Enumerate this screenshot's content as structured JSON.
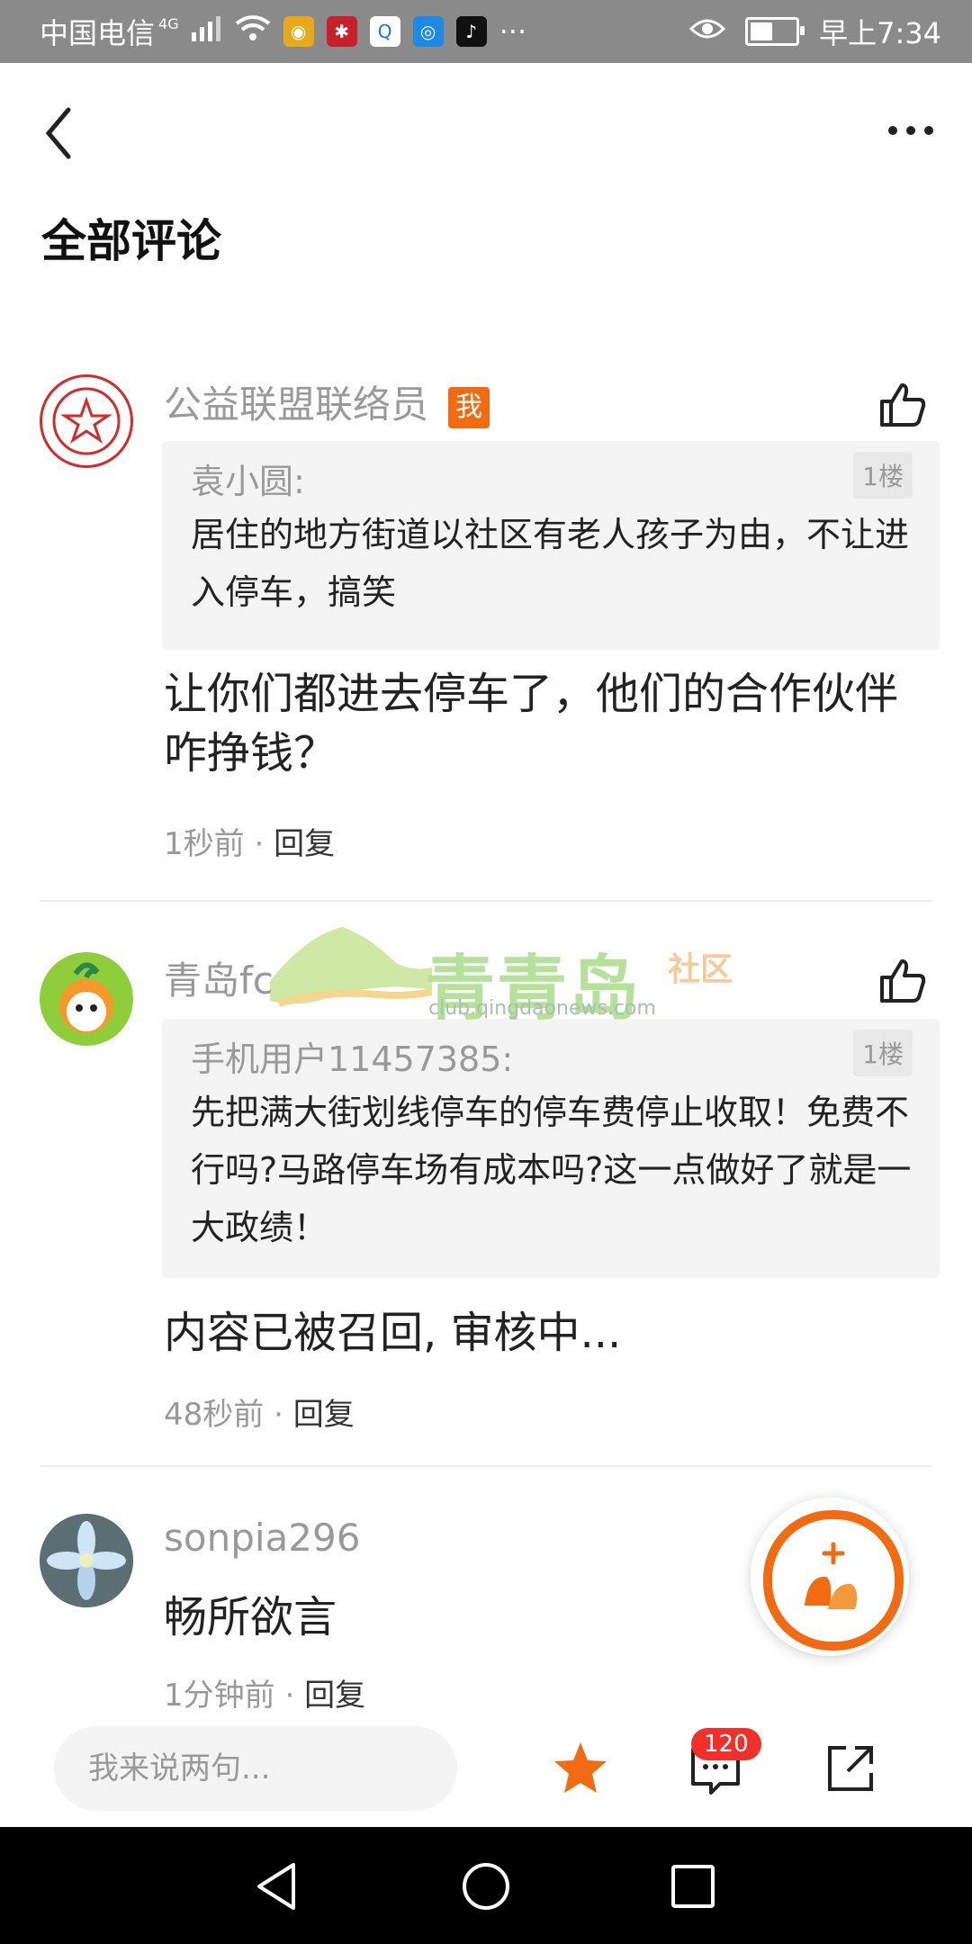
{
  "status_bar": {
    "carrier": "中国电信",
    "network": "4G",
    "more": "···",
    "time": "早上7:34"
  },
  "header": {
    "title": "全部评论"
  },
  "comments": [
    {
      "username": "公益联盟联络员",
      "me_tag": "我",
      "quote": {
        "user": "袁小圆:",
        "floor": "1楼",
        "text": "居住的地方街道以社区有老人孩子为由，不让进入停车，搞笑"
      },
      "text": "让你们都进去停车了，他们的合作伙伴咋挣钱？",
      "time": "1秒前",
      "separator": " · ",
      "reply": "回复"
    },
    {
      "username": "青岛fc",
      "quote": {
        "user": "手机用户11457385:",
        "floor": "1楼",
        "text": "先把满大街划线停车的停车费停止收取！免费不行吗?马路停车场有成本吗?这一点做好了就是一大政绩！"
      },
      "text": "内容已被召回, 审核中...",
      "time": "48秒前",
      "separator": " · ",
      "reply": "回复"
    },
    {
      "username": "sonpia296",
      "text": "畅所欲言",
      "time": "1分钟前",
      "separator": " · ",
      "reply": "回复"
    }
  ],
  "watermark": {
    "name": "青青岛",
    "suffix": "社区",
    "url": "club.qingdaonews.com"
  },
  "bottom_bar": {
    "input_placeholder": "我来说两句...",
    "comment_count": "120"
  },
  "colors": {
    "accent": "#f26b12",
    "badge_red": "#f0302a"
  }
}
